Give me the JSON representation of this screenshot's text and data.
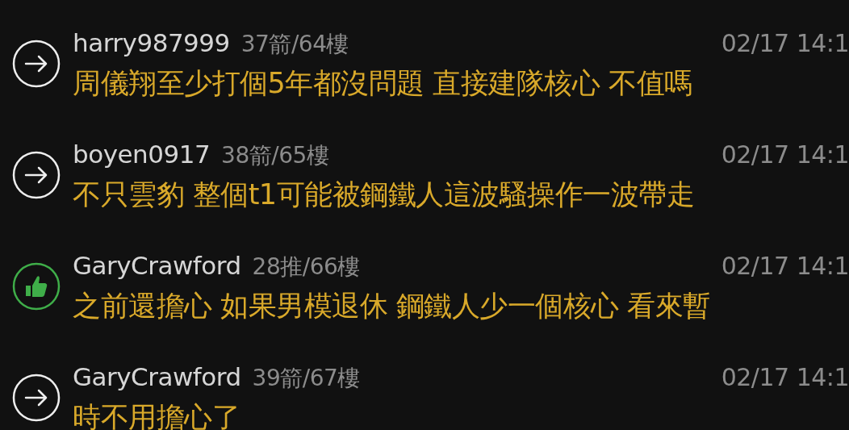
{
  "comments": [
    {
      "kind": "arrow",
      "user": "harry987999",
      "floor": "37箭/64樓",
      "time": "02/17 14:1",
      "text": "周儀翔至少打個5年都沒問題 直接建隊核心 不值嗎"
    },
    {
      "kind": "arrow",
      "user": "boyen0917",
      "floor": "38箭/65樓",
      "time": "02/17 14:1",
      "text": "不只雲豹 整個t1可能被鋼鐵人這波騷操作一波帶走"
    },
    {
      "kind": "push",
      "user": "GaryCrawford",
      "floor": "28推/66樓",
      "time": "02/17 14:1",
      "text": "之前還擔心 如果男模退休 鋼鐵人少一個核心 看來暫"
    },
    {
      "kind": "arrow",
      "user": "GaryCrawford",
      "floor": "39箭/67樓",
      "time": "02/17 14:1",
      "text": "時不用擔心了"
    }
  ]
}
